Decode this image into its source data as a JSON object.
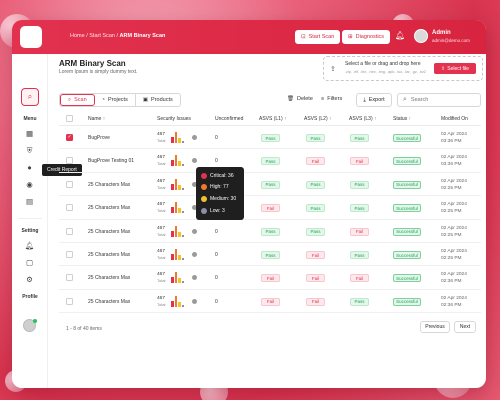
{
  "header": {
    "breadcrumb_prefix": "Home / Start Scan / ",
    "breadcrumb_current": "ARM Binary Scan",
    "start_scan_label": "Start Scan",
    "diagnostics_label": "Diagnostics",
    "user_name": "Admin",
    "user_email": "admin@demo.com"
  },
  "sidebar": {
    "menu_label": "Menu",
    "setting_label": "Setting",
    "profile_label": "Profile",
    "tooltip": "Credit Report"
  },
  "page": {
    "title": "ARM Binary Scan",
    "subtitle": "Lorem Ipsum is simply dummy text."
  },
  "upload": {
    "title": "Select a file or drag and drop here",
    "types": ".zip, .elf, .bin, .hex, .img, .apk, .iso, .tar, .gz, .bz2",
    "button_label": "Select file"
  },
  "tabs": [
    {
      "label": "Scan"
    },
    {
      "label": "Projects"
    },
    {
      "label": "Products"
    }
  ],
  "actions": {
    "delete_label": "Delete",
    "filters_label": "Filters",
    "export_label": "Export",
    "search_placeholder": "Search"
  },
  "table": {
    "headers": {
      "name": "Name",
      "security": "Security Issues",
      "unconfirmed": "Unconfirmed",
      "asvs1": "ASVS (L1)",
      "asvs2": "ASVS (L2)",
      "asvs3": "ASVS (L3)",
      "status": "Status",
      "modified": "Modified On"
    },
    "rows": [
      {
        "name": "BugProve",
        "issues": "467",
        "total": "Total",
        "unconfirmed": "0",
        "a1": "Pass",
        "a2": "Pass",
        "a3": "Pass",
        "status": "Successful",
        "date": "02 Apr 2024",
        "time": "03:36 PM",
        "checked": true
      },
      {
        "name": "BugProve Testing 01",
        "issues": "467",
        "total": "Total",
        "unconfirmed": "0",
        "a1": "Pass",
        "a2": "Fail",
        "a3": "Fail",
        "status": "Successful",
        "date": "02 Apr 2024",
        "time": "03:36 PM",
        "checked": false
      },
      {
        "name": "25 Characters Max",
        "issues": "467",
        "total": "Total",
        "unconfirmed": "0",
        "a1": "Pass",
        "a2": "Pass",
        "a3": "Pass",
        "status": "Successful",
        "date": "02 Apr 2024",
        "time": "02:25 PM",
        "checked": false
      },
      {
        "name": "25 Characters Max",
        "issues": "467",
        "total": "Total",
        "unconfirmed": "0",
        "a1": "Fail",
        "a2": "Pass",
        "a3": "Pass",
        "status": "Successful",
        "date": "02 Apr 2024",
        "time": "02:25 PM",
        "checked": false
      },
      {
        "name": "25 Characters Max",
        "issues": "467",
        "total": "Total",
        "unconfirmed": "0",
        "a1": "Pass",
        "a2": "Pass",
        "a3": "Fail",
        "status": "Successful",
        "date": "02 Apr 2024",
        "time": "02:25 PM",
        "checked": false
      },
      {
        "name": "25 Characters Max",
        "issues": "467",
        "total": "Total",
        "unconfirmed": "0",
        "a1": "Pass",
        "a2": "Fail",
        "a3": "Pass",
        "status": "Successful",
        "date": "02 Apr 2024",
        "time": "02:25 PM",
        "checked": false
      },
      {
        "name": "25 Characters Max",
        "issues": "467",
        "total": "Total",
        "unconfirmed": "0",
        "a1": "Fail",
        "a2": "Fail",
        "a3": "Fail",
        "status": "Successful",
        "date": "02 Apr 2024",
        "time": "02:36 PM",
        "checked": false
      },
      {
        "name": "25 Characters Max",
        "issues": "467",
        "total": "Total",
        "unconfirmed": "0",
        "a1": "Fail",
        "a2": "Fail",
        "a3": "Pass",
        "status": "Successful",
        "date": "02 Apr 2024",
        "time": "02:36 PM",
        "checked": false
      }
    ]
  },
  "popup": {
    "critical": "Critical: 36",
    "high": "High: 77",
    "medium": "Medium: 30",
    "low": "Low: 3"
  },
  "pagination": {
    "summary": "1 - 8 of 40 items",
    "prev_label": "Previous",
    "next_label": "Next"
  },
  "colors": {
    "brand": "#e2324f",
    "pass": "#22a15a",
    "critical": "#e2324f",
    "high": "#f07a2a",
    "medium": "#f2c12e",
    "low": "#8d8fa8"
  }
}
